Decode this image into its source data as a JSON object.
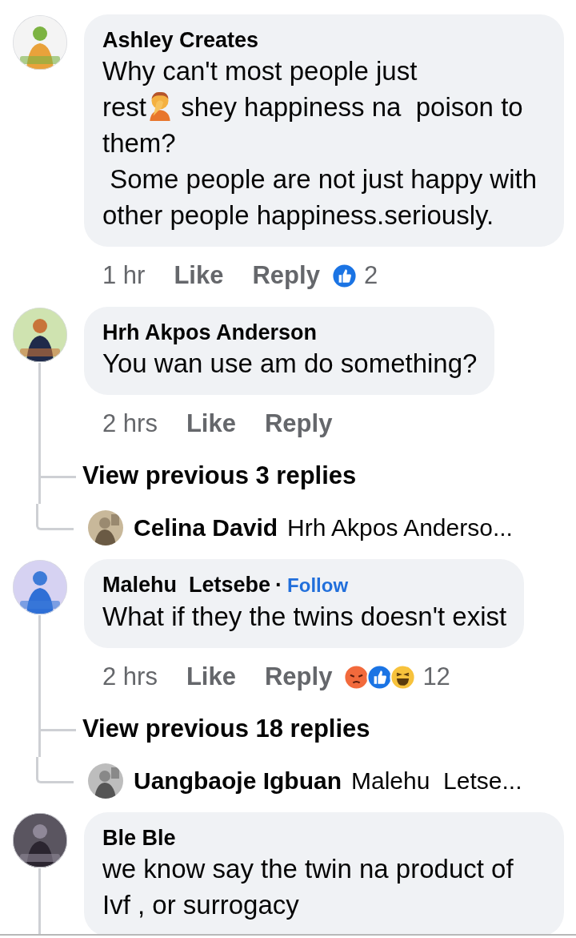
{
  "comments": [
    {
      "author": "Ashley Creates",
      "body": [
        {
          "kind": "text",
          "text": "Why can't most people just\nrest"
        },
        {
          "kind": "facepalm"
        },
        {
          "kind": "text",
          "text": " shey happiness na  poison to them?\n Some people are not just happy with other people happiness.seriously."
        }
      ],
      "time": "1 hr",
      "like": "Like",
      "reply": "Reply",
      "reactions": [
        {
          "kind": "like"
        }
      ],
      "reaction_count": "2",
      "thread_line": false
    },
    {
      "author": "Hrh Akpos Anderson",
      "body": [
        {
          "kind": "text",
          "text": "You wan use am do something?"
        }
      ],
      "time": "2 hrs",
      "like": "Like",
      "reply": "Reply",
      "thread_line": true,
      "thread": [
        {
          "kind": "more",
          "text": "View previous 3 replies"
        },
        {
          "kind": "preview",
          "author": "Celina David",
          "text": "Hrh Akpos Anderso..."
        }
      ]
    },
    {
      "author": "Malehu  Letsebe",
      "follow": {
        "separator": "·",
        "label": "Follow"
      },
      "body": [
        {
          "kind": "text",
          "text": "What if they the twins doesn't exist"
        }
      ],
      "time": "2 hrs",
      "like": "Like",
      "reply": "Reply",
      "reactions": [
        {
          "kind": "angry"
        },
        {
          "kind": "like"
        },
        {
          "kind": "haha"
        }
      ],
      "reaction_count": "12",
      "thread_line": true,
      "thread": [
        {
          "kind": "more",
          "text": "View previous 18 replies"
        },
        {
          "kind": "preview",
          "author": "Uangbaoje Igbuan",
          "text": "Malehu  Letse..."
        }
      ]
    },
    {
      "author": "Ble Ble",
      "body": [
        {
          "kind": "text",
          "text": "we know say the twin na product of Ivf , or surrogacy"
        }
      ],
      "thread_line": true
    }
  ]
}
